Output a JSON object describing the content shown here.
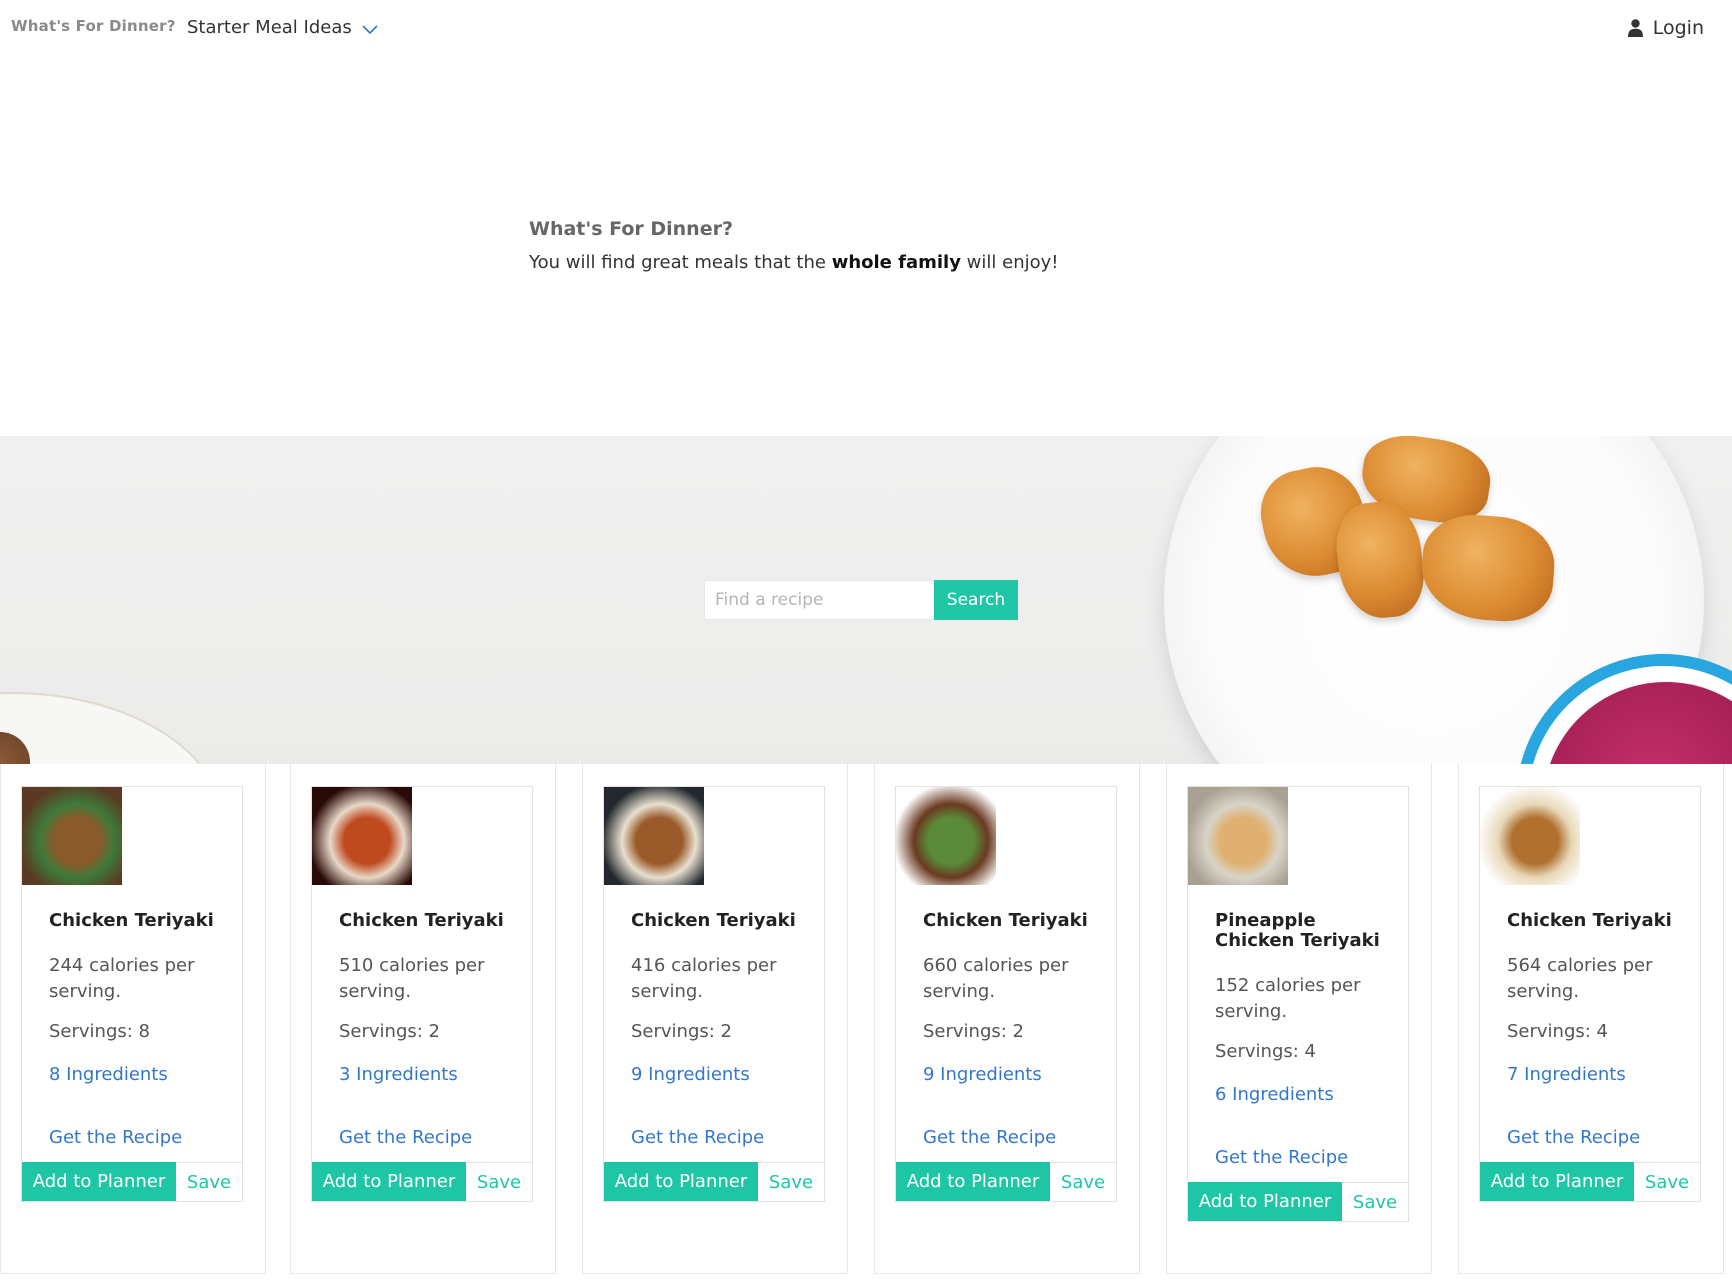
{
  "nav": {
    "brand": "What's For Dinner?",
    "menu_label": "Starter Meal Ideas",
    "login_label": "Login"
  },
  "hero": {
    "title": "What's For Dinner?",
    "subtitle_before": "You will find great meals that the ",
    "subtitle_bold": "whole family",
    "subtitle_after": " will enjoy!"
  },
  "search": {
    "placeholder": "Find a recipe",
    "button_label": "Search"
  },
  "colors": {
    "accent": "#1fc6a6",
    "link": "#3377cc"
  },
  "cards": [
    {
      "title": "Chicken Teriyaki",
      "calories": "244 calories per serving.",
      "servings": "Servings: 8",
      "ingredients": "8 Ingredients",
      "recipe_link": "Get the Recipe",
      "plan_label": "Add to Planner",
      "save_label": "Save"
    },
    {
      "title": "Chicken Teriyaki",
      "calories": "510 calories per serving.",
      "servings": "Servings: 2",
      "ingredients": "3 Ingredients",
      "recipe_link": "Get the Recipe",
      "plan_label": "Add to Planner",
      "save_label": "Save"
    },
    {
      "title": "Chicken Teriyaki",
      "calories": "416 calories per serving.",
      "servings": "Servings: 2",
      "ingredients": "9 Ingredients",
      "recipe_link": "Get the Recipe",
      "plan_label": "Add to Planner",
      "save_label": "Save"
    },
    {
      "title": "Chicken Teriyaki",
      "calories": "660 calories per serving.",
      "servings": "Servings: 2",
      "ingredients": "9 Ingredients",
      "recipe_link": "Get the Recipe",
      "plan_label": "Add to Planner",
      "save_label": "Save"
    },
    {
      "title": "Pineapple Chicken Teriyaki",
      "calories": "152 calories per serving.",
      "servings": "Servings: 4",
      "ingredients": "6 Ingredients",
      "recipe_link": "Get the Recipe",
      "plan_label": "Add to Planner",
      "save_label": "Save"
    },
    {
      "title": "Chicken Teriyaki",
      "calories": "564 calories per serving.",
      "servings": "Servings: 4",
      "ingredients": "7 Ingredients",
      "recipe_link": "Get the Recipe",
      "plan_label": "Add to Planner",
      "save_label": "Save"
    }
  ]
}
